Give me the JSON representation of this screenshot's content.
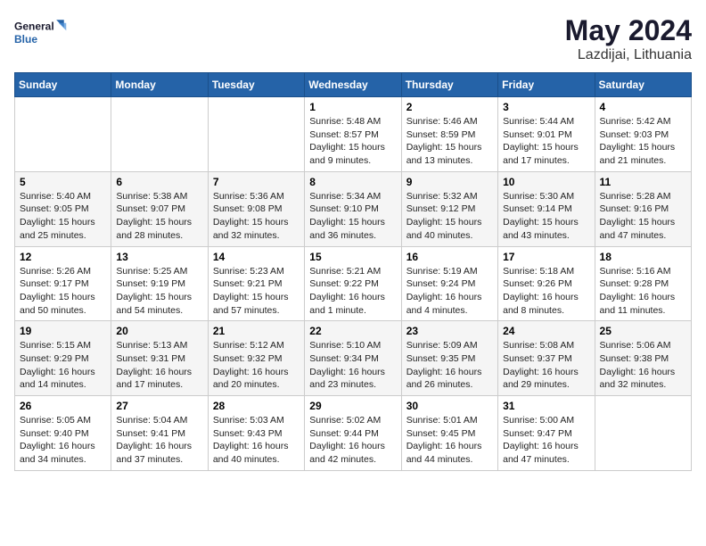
{
  "header": {
    "logo_line1": "General",
    "logo_line2": "Blue",
    "month": "May 2024",
    "location": "Lazdijai, Lithuania"
  },
  "weekdays": [
    "Sunday",
    "Monday",
    "Tuesday",
    "Wednesday",
    "Thursday",
    "Friday",
    "Saturday"
  ],
  "weeks": [
    [
      {
        "day": "",
        "info": ""
      },
      {
        "day": "",
        "info": ""
      },
      {
        "day": "",
        "info": ""
      },
      {
        "day": "1",
        "info": "Sunrise: 5:48 AM\nSunset: 8:57 PM\nDaylight: 15 hours\nand 9 minutes."
      },
      {
        "day": "2",
        "info": "Sunrise: 5:46 AM\nSunset: 8:59 PM\nDaylight: 15 hours\nand 13 minutes."
      },
      {
        "day": "3",
        "info": "Sunrise: 5:44 AM\nSunset: 9:01 PM\nDaylight: 15 hours\nand 17 minutes."
      },
      {
        "day": "4",
        "info": "Sunrise: 5:42 AM\nSunset: 9:03 PM\nDaylight: 15 hours\nand 21 minutes."
      }
    ],
    [
      {
        "day": "5",
        "info": "Sunrise: 5:40 AM\nSunset: 9:05 PM\nDaylight: 15 hours\nand 25 minutes."
      },
      {
        "day": "6",
        "info": "Sunrise: 5:38 AM\nSunset: 9:07 PM\nDaylight: 15 hours\nand 28 minutes."
      },
      {
        "day": "7",
        "info": "Sunrise: 5:36 AM\nSunset: 9:08 PM\nDaylight: 15 hours\nand 32 minutes."
      },
      {
        "day": "8",
        "info": "Sunrise: 5:34 AM\nSunset: 9:10 PM\nDaylight: 15 hours\nand 36 minutes."
      },
      {
        "day": "9",
        "info": "Sunrise: 5:32 AM\nSunset: 9:12 PM\nDaylight: 15 hours\nand 40 minutes."
      },
      {
        "day": "10",
        "info": "Sunrise: 5:30 AM\nSunset: 9:14 PM\nDaylight: 15 hours\nand 43 minutes."
      },
      {
        "day": "11",
        "info": "Sunrise: 5:28 AM\nSunset: 9:16 PM\nDaylight: 15 hours\nand 47 minutes."
      }
    ],
    [
      {
        "day": "12",
        "info": "Sunrise: 5:26 AM\nSunset: 9:17 PM\nDaylight: 15 hours\nand 50 minutes."
      },
      {
        "day": "13",
        "info": "Sunrise: 5:25 AM\nSunset: 9:19 PM\nDaylight: 15 hours\nand 54 minutes."
      },
      {
        "day": "14",
        "info": "Sunrise: 5:23 AM\nSunset: 9:21 PM\nDaylight: 15 hours\nand 57 minutes."
      },
      {
        "day": "15",
        "info": "Sunrise: 5:21 AM\nSunset: 9:22 PM\nDaylight: 16 hours\nand 1 minute."
      },
      {
        "day": "16",
        "info": "Sunrise: 5:19 AM\nSunset: 9:24 PM\nDaylight: 16 hours\nand 4 minutes."
      },
      {
        "day": "17",
        "info": "Sunrise: 5:18 AM\nSunset: 9:26 PM\nDaylight: 16 hours\nand 8 minutes."
      },
      {
        "day": "18",
        "info": "Sunrise: 5:16 AM\nSunset: 9:28 PM\nDaylight: 16 hours\nand 11 minutes."
      }
    ],
    [
      {
        "day": "19",
        "info": "Sunrise: 5:15 AM\nSunset: 9:29 PM\nDaylight: 16 hours\nand 14 minutes."
      },
      {
        "day": "20",
        "info": "Sunrise: 5:13 AM\nSunset: 9:31 PM\nDaylight: 16 hours\nand 17 minutes."
      },
      {
        "day": "21",
        "info": "Sunrise: 5:12 AM\nSunset: 9:32 PM\nDaylight: 16 hours\nand 20 minutes."
      },
      {
        "day": "22",
        "info": "Sunrise: 5:10 AM\nSunset: 9:34 PM\nDaylight: 16 hours\nand 23 minutes."
      },
      {
        "day": "23",
        "info": "Sunrise: 5:09 AM\nSunset: 9:35 PM\nDaylight: 16 hours\nand 26 minutes."
      },
      {
        "day": "24",
        "info": "Sunrise: 5:08 AM\nSunset: 9:37 PM\nDaylight: 16 hours\nand 29 minutes."
      },
      {
        "day": "25",
        "info": "Sunrise: 5:06 AM\nSunset: 9:38 PM\nDaylight: 16 hours\nand 32 minutes."
      }
    ],
    [
      {
        "day": "26",
        "info": "Sunrise: 5:05 AM\nSunset: 9:40 PM\nDaylight: 16 hours\nand 34 minutes."
      },
      {
        "day": "27",
        "info": "Sunrise: 5:04 AM\nSunset: 9:41 PM\nDaylight: 16 hours\nand 37 minutes."
      },
      {
        "day": "28",
        "info": "Sunrise: 5:03 AM\nSunset: 9:43 PM\nDaylight: 16 hours\nand 40 minutes."
      },
      {
        "day": "29",
        "info": "Sunrise: 5:02 AM\nSunset: 9:44 PM\nDaylight: 16 hours\nand 42 minutes."
      },
      {
        "day": "30",
        "info": "Sunrise: 5:01 AM\nSunset: 9:45 PM\nDaylight: 16 hours\nand 44 minutes."
      },
      {
        "day": "31",
        "info": "Sunrise: 5:00 AM\nSunset: 9:47 PM\nDaylight: 16 hours\nand 47 minutes."
      },
      {
        "day": "",
        "info": ""
      }
    ]
  ]
}
